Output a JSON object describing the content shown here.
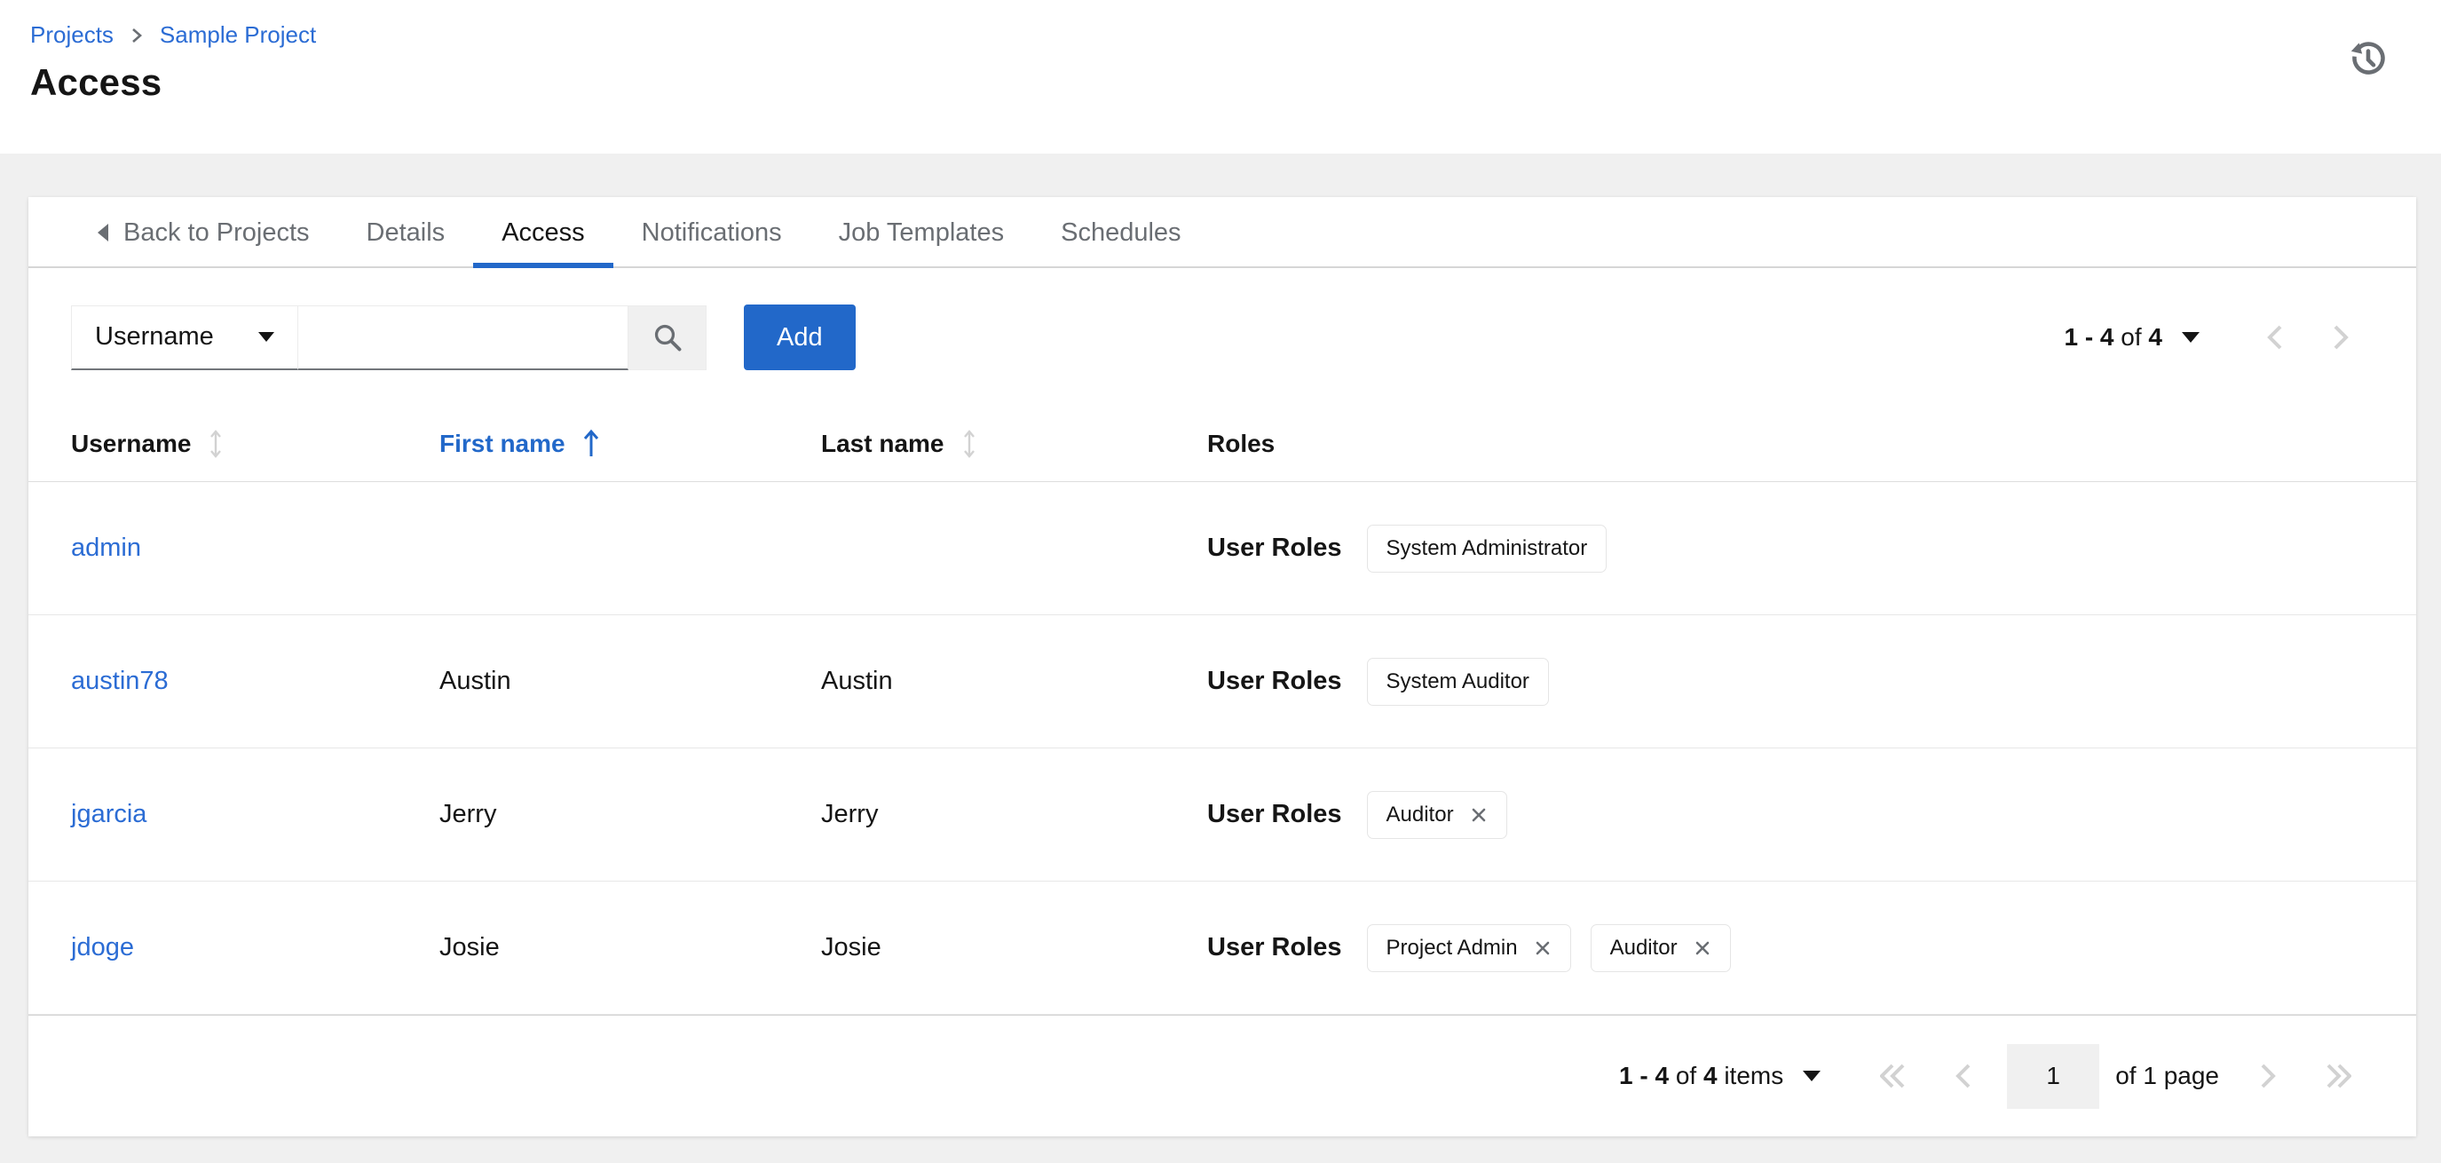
{
  "breadcrumb": {
    "items": [
      {
        "label": "Projects"
      },
      {
        "label": "Sample Project"
      }
    ]
  },
  "page": {
    "title": "Access"
  },
  "tabs": {
    "back_label": "Back to Projects",
    "items": [
      {
        "label": "Details",
        "active": false
      },
      {
        "label": "Access",
        "active": true
      },
      {
        "label": "Notifications",
        "active": false
      },
      {
        "label": "Job Templates",
        "active": false
      },
      {
        "label": "Schedules",
        "active": false
      }
    ]
  },
  "toolbar": {
    "filter_selected": "Username",
    "search_value": "",
    "search_placeholder": "",
    "add_label": "Add",
    "pagination": {
      "range": "1 - 4",
      "of": "of",
      "total": "4"
    }
  },
  "table": {
    "columns": [
      {
        "label": "Username",
        "sort": "sortable"
      },
      {
        "label": "First name",
        "sort": "ascending"
      },
      {
        "label": "Last name",
        "sort": "sortable"
      },
      {
        "label": "Roles",
        "sort": "none"
      }
    ],
    "roles_label": "User Roles",
    "rows": [
      {
        "username": "admin",
        "first": "",
        "last": "",
        "chips": [
          {
            "label": "System Administrator",
            "removable": false
          }
        ]
      },
      {
        "username": "austin78",
        "first": "Austin",
        "last": "Austin",
        "chips": [
          {
            "label": "System Auditor",
            "removable": false
          }
        ]
      },
      {
        "username": "jgarcia",
        "first": "Jerry",
        "last": "Jerry",
        "chips": [
          {
            "label": "Auditor",
            "removable": true
          }
        ]
      },
      {
        "username": "jdoge",
        "first": "Josie",
        "last": "Josie",
        "chips": [
          {
            "label": "Project Admin",
            "removable": true
          },
          {
            "label": "Auditor",
            "removable": true
          }
        ]
      }
    ]
  },
  "footer": {
    "items_range": "1 - 4",
    "items_of": "of",
    "items_total": "4",
    "items_word": "items",
    "page_value": "1",
    "of_page_text": "of 1 page"
  },
  "icons": {
    "history": "clock-with-counterclockwise-arrow",
    "search": "magnifier",
    "sort_inactive": "vertical-double-arrow",
    "sort_active": "up-arrow",
    "caret": "filled-triangle-down",
    "chip_close": "x-mark",
    "back": "left-filled-triangle"
  },
  "colors": {
    "primary": "#2268c9",
    "link": "#2b6cd4",
    "muted_text": "#6a6e73",
    "disabled": "#d2d2d2",
    "page_bg": "#f0f0f0",
    "text": "#151515"
  }
}
